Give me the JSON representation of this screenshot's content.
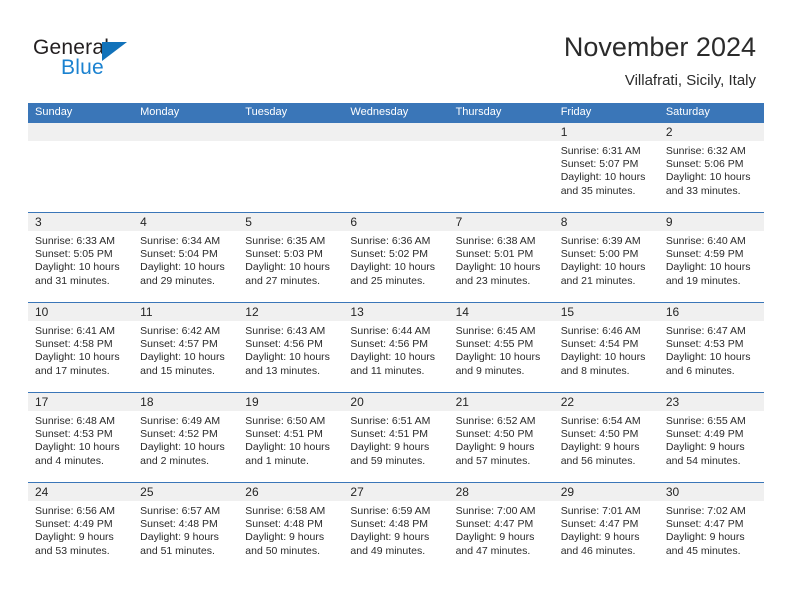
{
  "brand": {
    "name_part1": "General",
    "name_part2": "Blue",
    "accent_color": "#1b82d0",
    "triangle_color": "#1172ba"
  },
  "header": {
    "title": "November 2024",
    "subtitle": "Villafrati, Sicily, Italy"
  },
  "theme": {
    "header_blue": "#3a76b8",
    "day_band_gray": "#f0f0f0",
    "text_color": "#2a2a2a"
  },
  "weekdays": [
    "Sunday",
    "Monday",
    "Tuesday",
    "Wednesday",
    "Thursday",
    "Friday",
    "Saturday"
  ],
  "weeks": [
    [
      {
        "day": "",
        "empty": true
      },
      {
        "day": "",
        "empty": true
      },
      {
        "day": "",
        "empty": true
      },
      {
        "day": "",
        "empty": true
      },
      {
        "day": "",
        "empty": true
      },
      {
        "day": "1",
        "sunrise": "Sunrise: 6:31 AM",
        "sunset": "Sunset: 5:07 PM",
        "daylight": "Daylight: 10 hours and 35 minutes."
      },
      {
        "day": "2",
        "sunrise": "Sunrise: 6:32 AM",
        "sunset": "Sunset: 5:06 PM",
        "daylight": "Daylight: 10 hours and 33 minutes."
      }
    ],
    [
      {
        "day": "3",
        "sunrise": "Sunrise: 6:33 AM",
        "sunset": "Sunset: 5:05 PM",
        "daylight": "Daylight: 10 hours and 31 minutes."
      },
      {
        "day": "4",
        "sunrise": "Sunrise: 6:34 AM",
        "sunset": "Sunset: 5:04 PM",
        "daylight": "Daylight: 10 hours and 29 minutes."
      },
      {
        "day": "5",
        "sunrise": "Sunrise: 6:35 AM",
        "sunset": "Sunset: 5:03 PM",
        "daylight": "Daylight: 10 hours and 27 minutes."
      },
      {
        "day": "6",
        "sunrise": "Sunrise: 6:36 AM",
        "sunset": "Sunset: 5:02 PM",
        "daylight": "Daylight: 10 hours and 25 minutes."
      },
      {
        "day": "7",
        "sunrise": "Sunrise: 6:38 AM",
        "sunset": "Sunset: 5:01 PM",
        "daylight": "Daylight: 10 hours and 23 minutes."
      },
      {
        "day": "8",
        "sunrise": "Sunrise: 6:39 AM",
        "sunset": "Sunset: 5:00 PM",
        "daylight": "Daylight: 10 hours and 21 minutes."
      },
      {
        "day": "9",
        "sunrise": "Sunrise: 6:40 AM",
        "sunset": "Sunset: 4:59 PM",
        "daylight": "Daylight: 10 hours and 19 minutes."
      }
    ],
    [
      {
        "day": "10",
        "sunrise": "Sunrise: 6:41 AM",
        "sunset": "Sunset: 4:58 PM",
        "daylight": "Daylight: 10 hours and 17 minutes."
      },
      {
        "day": "11",
        "sunrise": "Sunrise: 6:42 AM",
        "sunset": "Sunset: 4:57 PM",
        "daylight": "Daylight: 10 hours and 15 minutes."
      },
      {
        "day": "12",
        "sunrise": "Sunrise: 6:43 AM",
        "sunset": "Sunset: 4:56 PM",
        "daylight": "Daylight: 10 hours and 13 minutes."
      },
      {
        "day": "13",
        "sunrise": "Sunrise: 6:44 AM",
        "sunset": "Sunset: 4:56 PM",
        "daylight": "Daylight: 10 hours and 11 minutes."
      },
      {
        "day": "14",
        "sunrise": "Sunrise: 6:45 AM",
        "sunset": "Sunset: 4:55 PM",
        "daylight": "Daylight: 10 hours and 9 minutes."
      },
      {
        "day": "15",
        "sunrise": "Sunrise: 6:46 AM",
        "sunset": "Sunset: 4:54 PM",
        "daylight": "Daylight: 10 hours and 8 minutes."
      },
      {
        "day": "16",
        "sunrise": "Sunrise: 6:47 AM",
        "sunset": "Sunset: 4:53 PM",
        "daylight": "Daylight: 10 hours and 6 minutes."
      }
    ],
    [
      {
        "day": "17",
        "sunrise": "Sunrise: 6:48 AM",
        "sunset": "Sunset: 4:53 PM",
        "daylight": "Daylight: 10 hours and 4 minutes."
      },
      {
        "day": "18",
        "sunrise": "Sunrise: 6:49 AM",
        "sunset": "Sunset: 4:52 PM",
        "daylight": "Daylight: 10 hours and 2 minutes."
      },
      {
        "day": "19",
        "sunrise": "Sunrise: 6:50 AM",
        "sunset": "Sunset: 4:51 PM",
        "daylight": "Daylight: 10 hours and 1 minute."
      },
      {
        "day": "20",
        "sunrise": "Sunrise: 6:51 AM",
        "sunset": "Sunset: 4:51 PM",
        "daylight": "Daylight: 9 hours and 59 minutes."
      },
      {
        "day": "21",
        "sunrise": "Sunrise: 6:52 AM",
        "sunset": "Sunset: 4:50 PM",
        "daylight": "Daylight: 9 hours and 57 minutes."
      },
      {
        "day": "22",
        "sunrise": "Sunrise: 6:54 AM",
        "sunset": "Sunset: 4:50 PM",
        "daylight": "Daylight: 9 hours and 56 minutes."
      },
      {
        "day": "23",
        "sunrise": "Sunrise: 6:55 AM",
        "sunset": "Sunset: 4:49 PM",
        "daylight": "Daylight: 9 hours and 54 minutes."
      }
    ],
    [
      {
        "day": "24",
        "sunrise": "Sunrise: 6:56 AM",
        "sunset": "Sunset: 4:49 PM",
        "daylight": "Daylight: 9 hours and 53 minutes."
      },
      {
        "day": "25",
        "sunrise": "Sunrise: 6:57 AM",
        "sunset": "Sunset: 4:48 PM",
        "daylight": "Daylight: 9 hours and 51 minutes."
      },
      {
        "day": "26",
        "sunrise": "Sunrise: 6:58 AM",
        "sunset": "Sunset: 4:48 PM",
        "daylight": "Daylight: 9 hours and 50 minutes."
      },
      {
        "day": "27",
        "sunrise": "Sunrise: 6:59 AM",
        "sunset": "Sunset: 4:48 PM",
        "daylight": "Daylight: 9 hours and 49 minutes."
      },
      {
        "day": "28",
        "sunrise": "Sunrise: 7:00 AM",
        "sunset": "Sunset: 4:47 PM",
        "daylight": "Daylight: 9 hours and 47 minutes."
      },
      {
        "day": "29",
        "sunrise": "Sunrise: 7:01 AM",
        "sunset": "Sunset: 4:47 PM",
        "daylight": "Daylight: 9 hours and 46 minutes."
      },
      {
        "day": "30",
        "sunrise": "Sunrise: 7:02 AM",
        "sunset": "Sunset: 4:47 PM",
        "daylight": "Daylight: 9 hours and 45 minutes."
      }
    ]
  ]
}
